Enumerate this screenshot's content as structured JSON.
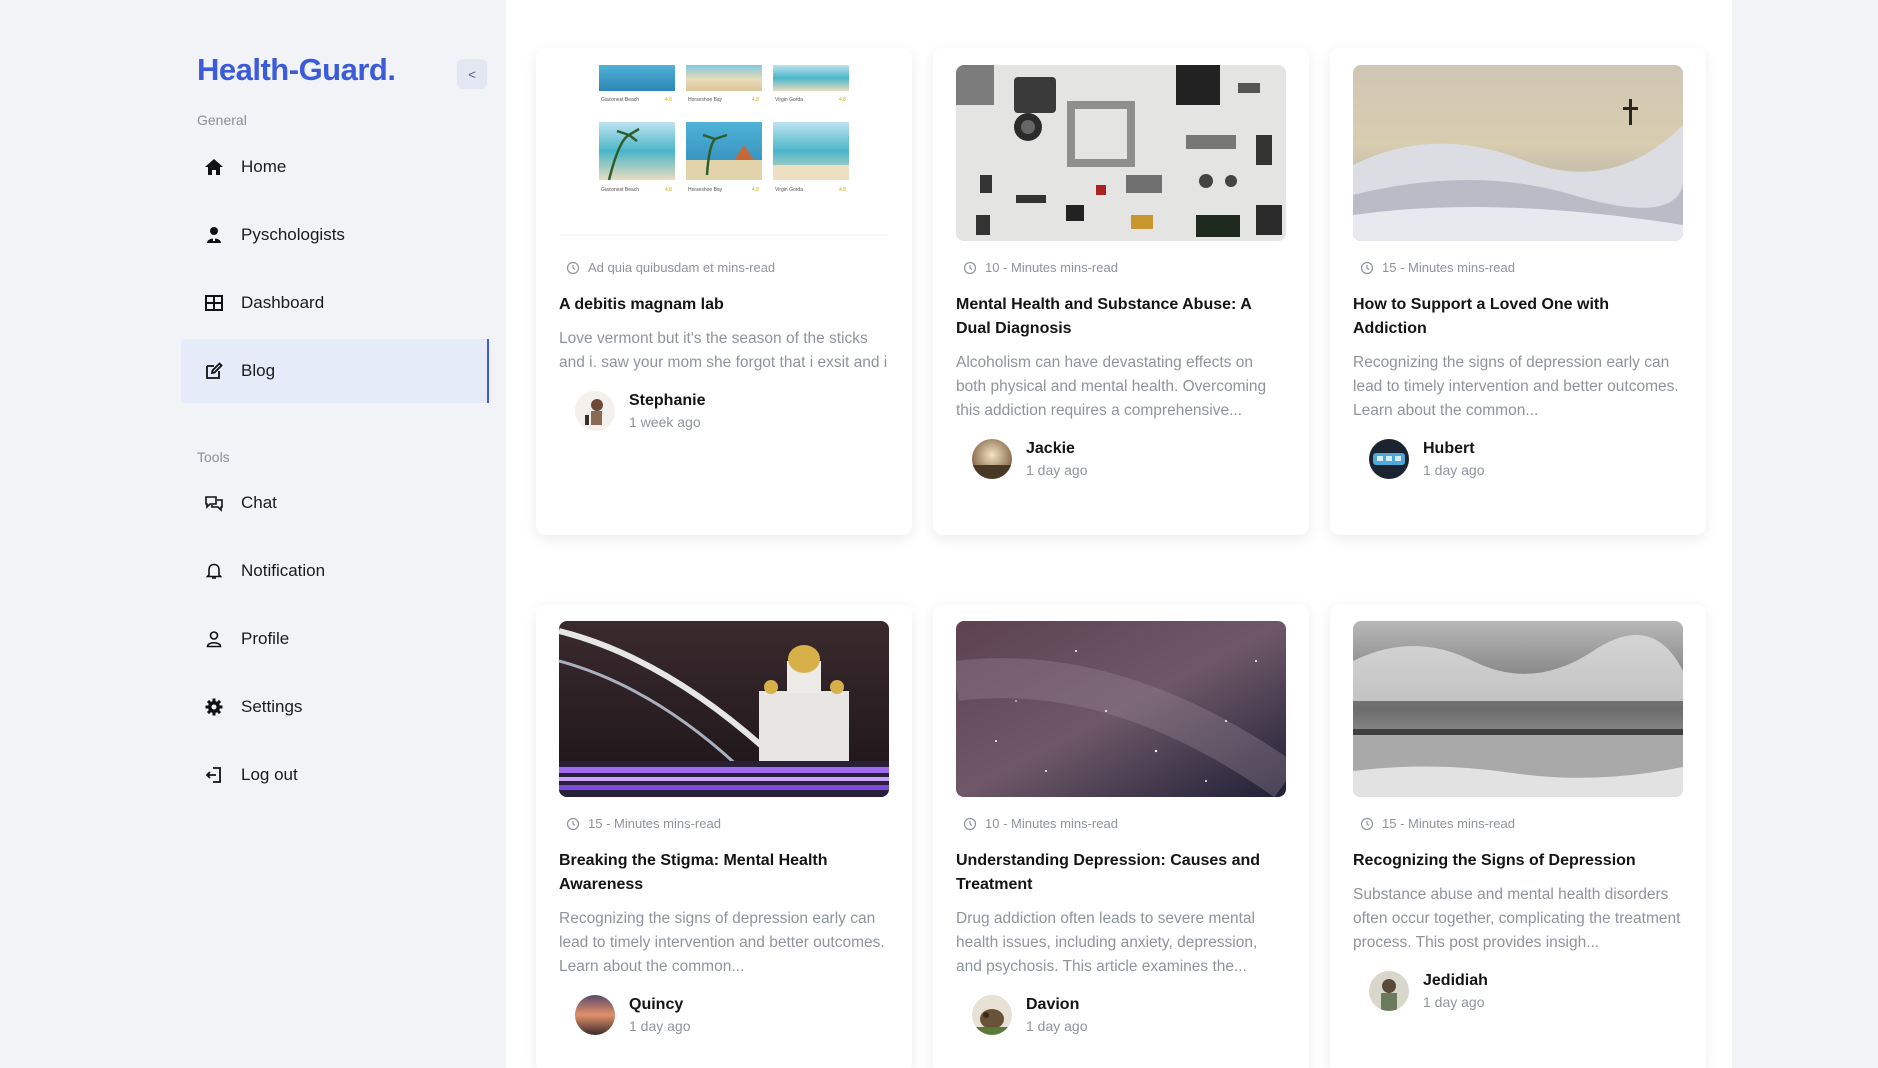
{
  "sidebar": {
    "brand": "Health-Guard.",
    "collapse_label": "<",
    "general_label": "General",
    "tools_label": "Tools",
    "general_items": [
      {
        "label": "Home",
        "icon": "home-icon"
      },
      {
        "label": "Pyschologists",
        "icon": "person-icon"
      },
      {
        "label": "Dashboard",
        "icon": "grid-icon"
      },
      {
        "label": "Blog",
        "icon": "edit-icon",
        "active": true
      }
    ],
    "tool_items": [
      {
        "label": "Chat",
        "icon": "chat-icon"
      },
      {
        "label": "Notification",
        "icon": "bell-icon"
      },
      {
        "label": "Profile",
        "icon": "user-icon"
      },
      {
        "label": "Settings",
        "icon": "gear-icon"
      },
      {
        "label": "Log out",
        "icon": "logout-icon"
      }
    ]
  },
  "posts": [
    {
      "read_time": "Ad quia quibusdam et mins-read",
      "title": "A debitis magnam lab",
      "excerpt": "Love vermont but it's the season of the sticks and i. saw your mom she forgot that i exsit and i",
      "author": "Stephanie",
      "time_ago": "1 week ago"
    },
    {
      "read_time": "10 - Minutes mins-read",
      "title": "Mental Health and Substance Abuse: A Dual Diagnosis",
      "excerpt": "Alcoholism can have devastating effects on both physical and mental health. Overcoming this addiction requires a comprehensive...",
      "author": "Jackie",
      "time_ago": "1 day ago"
    },
    {
      "read_time": "15 - Minutes mins-read",
      "title": "How to Support a Loved One with Addiction",
      "excerpt": "Recognizing the signs of depression early can lead to timely intervention and better outcomes. Learn about the common...",
      "author": "Hubert",
      "time_ago": "1 day ago"
    },
    {
      "read_time": "15 - Minutes mins-read",
      "title": "Breaking the Stigma: Mental Health Awareness",
      "excerpt": "Recognizing the signs of depression early can lead to timely intervention and better outcomes. Learn about the common...",
      "author": "Quincy",
      "time_ago": "1 day ago"
    },
    {
      "read_time": "10 - Minutes mins-read",
      "title": "Understanding Depression: Causes and Treatment",
      "excerpt": "Drug addiction often leads to severe mental health issues, including anxiety, depression, and psychosis. This article examines the...",
      "author": "Davion",
      "time_ago": "1 day ago"
    },
    {
      "read_time": "15 - Minutes mins-read",
      "title": "Recognizing the Signs of Depression",
      "excerpt": "Substance abuse and mental health disorders often occur together, complicating the treatment process. This post provides insigh...",
      "author": "Jedidiah",
      "time_ago": "1 day ago"
    }
  ],
  "thumb_text": {
    "a": "Giaconest Beach",
    "b": "Horseshoe Bay",
    "c": "Virgin Gorda",
    "rating": "4.8"
  }
}
